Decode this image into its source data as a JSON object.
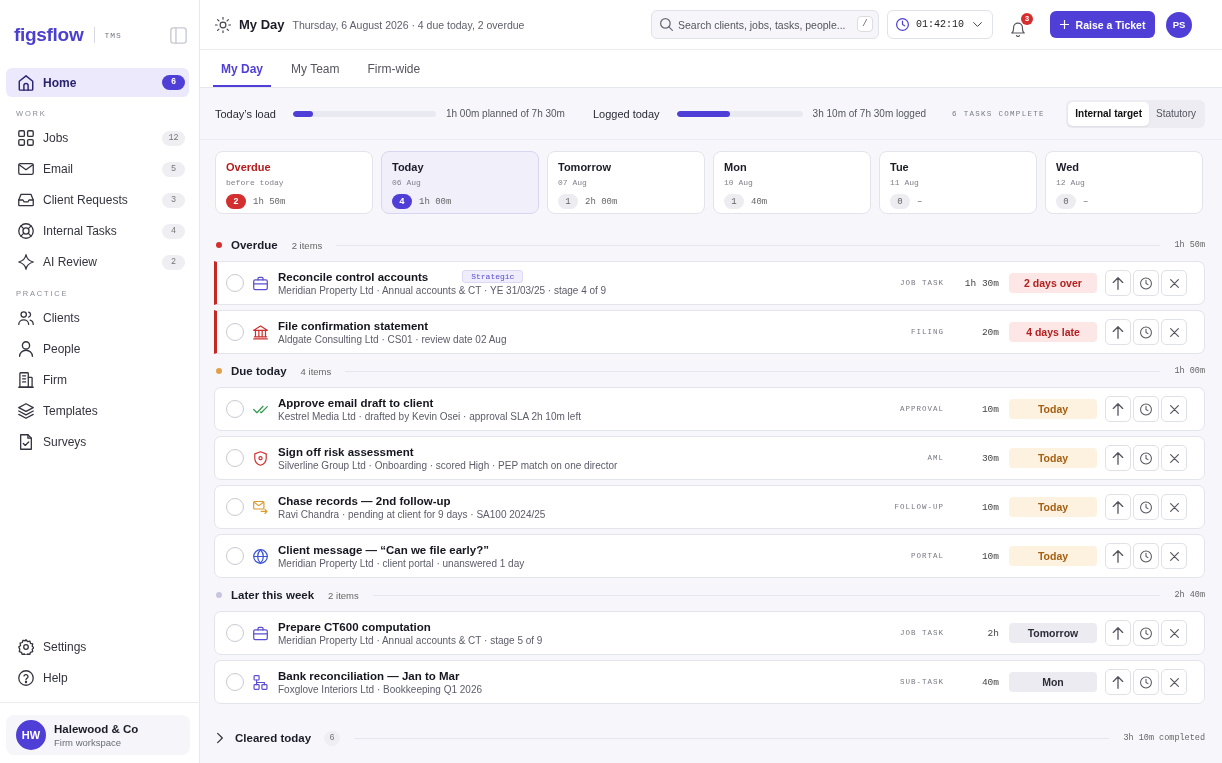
{
  "sidebar": {
    "brand": "figsflow",
    "product": "TMS",
    "sections": [
      {
        "items": [
          {
            "label": "Home",
            "count": "6",
            "selected": true
          }
        ]
      },
      {
        "heading": "WORK",
        "items": [
          {
            "label": "Jobs",
            "count": "12",
            "selected": false
          },
          {
            "label": "Email",
            "count": "5",
            "selected": false
          },
          {
            "label": "Client Requests",
            "count": "3",
            "selected": false
          },
          {
            "label": "Internal Tasks",
            "count": "4",
            "selected": false
          },
          {
            "label": "AI Review",
            "count": "2",
            "selected": false
          }
        ]
      },
      {
        "heading": "PRACTICE",
        "items": [
          {
            "label": "Clients",
            "selected": false
          },
          {
            "label": "People",
            "selected": false
          },
          {
            "label": "Firm",
            "selected": false
          },
          {
            "label": "Templates",
            "selected": false
          },
          {
            "label": "Surveys",
            "selected": false
          }
        ]
      }
    ],
    "footer_items": [
      {
        "label": "Settings",
        "selected": false
      },
      {
        "label": "Help",
        "selected": false
      }
    ],
    "workspace": {
      "initials": "HW",
      "name": "Halewood & Co",
      "subtitle": "Firm workspace"
    }
  },
  "header": {
    "title": "My Day",
    "subtitle": "Thursday, 6 August 2026 · 4 due today, 2 overdue",
    "search": {
      "placeholder": "Search clients, jobs, tasks, people...",
      "shortcut": "/"
    },
    "timer": "01:42:10",
    "notifications": "3",
    "primary_button": "Raise a Ticket",
    "avatar": "PS"
  },
  "tabs": [
    {
      "label": "My Day",
      "selected": true
    },
    {
      "label": "My Team",
      "selected": false
    },
    {
      "label": "Firm-wide",
      "selected": false
    }
  ],
  "load": {
    "meters": [
      {
        "label": "Today’s load",
        "level": 0.14,
        "reading": "1h 00m planned of 7h 30m"
      },
      {
        "label": "Logged today",
        "level": 0.42,
        "reading": "3h 10m of 7h 30m logged"
      }
    ],
    "completed": "6 TASKS COMPLETE",
    "target_options": [
      {
        "label": "Internal target",
        "selected": true
      },
      {
        "label": "Statutory",
        "selected": false
      }
    ]
  },
  "day_cards": [
    {
      "kind": "overdue",
      "title": "Overdue",
      "subtitle": "before today",
      "count": "2",
      "duration": "1h 50m",
      "selected": false
    },
    {
      "kind": "day",
      "title": "Today",
      "subtitle": "06 Aug",
      "count": "4",
      "duration": "1h 00m",
      "selected": true
    },
    {
      "kind": "day",
      "title": "Tomorrow",
      "subtitle": "07 Aug",
      "count": "1",
      "duration": "2h 00m",
      "selected": false
    },
    {
      "kind": "day",
      "title": "Mon",
      "subtitle": "10 Aug",
      "count": "1",
      "duration": "40m",
      "selected": false
    },
    {
      "kind": "day",
      "title": "Tue",
      "subtitle": "11 Aug",
      "count": "0",
      "duration": "–",
      "selected": false
    },
    {
      "kind": "day",
      "title": "Wed",
      "subtitle": "12 Aug",
      "count": "0",
      "duration": "–",
      "selected": false
    }
  ],
  "sections": [
    {
      "title": "Overdue",
      "count": "2 items",
      "total": "1h 50m",
      "color": "#d32f2f",
      "rows": [
        {
          "kind": "job-task",
          "title": "Reconcile control accounts",
          "tag": "Strategic",
          "detail": "Meridian Property Ltd · Annual accounts & CT · YE 31/03/25 · stage 4 of 9",
          "type": "JOB TASK",
          "duration": "1h 30m",
          "status": {
            "kind": "late",
            "text": "2 days over"
          },
          "overdue": true,
          "checked": false
        },
        {
          "kind": "filing",
          "title": "File confirmation statement",
          "detail": "Aldgate Consulting Ltd · CS01 · review date 02 Aug",
          "type": "FILING",
          "duration": "20m",
          "status": {
            "kind": "late",
            "text": "4 days late"
          },
          "overdue": true,
          "checked": false
        }
      ]
    },
    {
      "title": "Due today",
      "count": "4 items",
      "total": "1h 00m",
      "color": "#e3a04a",
      "rows": [
        {
          "kind": "approval",
          "title": "Approve email draft to client",
          "detail": "Kestrel Media Ltd · drafted by Kevin Osei · approval SLA 2h 10m left",
          "type": "APPROVAL",
          "duration": "10m",
          "status": {
            "kind": "today",
            "text": "Today"
          },
          "overdue": false,
          "checked": false
        },
        {
          "kind": "aml",
          "title": "Sign off risk assessment",
          "detail": "Silverline Group Ltd · Onboarding · scored High · PEP match on one director",
          "type": "AML",
          "duration": "30m",
          "status": {
            "kind": "today",
            "text": "Today"
          },
          "overdue": false,
          "checked": false
        },
        {
          "kind": "follow-up",
          "title": "Chase records — 2nd follow-up",
          "detail": "Ravi Chandra · pending at client for 9 days · SA100 2024/25",
          "type": "FOLLOW-UP",
          "duration": "10m",
          "status": {
            "kind": "today",
            "text": "Today"
          },
          "overdue": false,
          "checked": false
        },
        {
          "kind": "portal",
          "title": "Client message — “Can we file early?”",
          "detail": "Meridian Property Ltd · client portal · unanswered 1 day",
          "type": "PORTAL",
          "duration": "10m",
          "status": {
            "kind": "today",
            "text": "Today"
          },
          "overdue": false,
          "checked": false
        }
      ]
    },
    {
      "title": "Later this week",
      "count": "2 items",
      "total": "2h 40m",
      "color": "#c8c5e2",
      "rows": [
        {
          "kind": "job-task",
          "title": "Prepare CT600 computation",
          "detail": "Meridian Property Ltd · Annual accounts & CT · stage 5 of 9",
          "type": "JOB TASK",
          "duration": "2h",
          "status": {
            "kind": "upcoming",
            "text": "Tomorrow"
          },
          "overdue": false,
          "checked": false
        },
        {
          "kind": "sub-task",
          "title": "Bank reconciliation — Jan to Mar",
          "detail": "Foxglove Interiors Ltd · Bookkeeping Q1 2026",
          "type": "SUB-TASK",
          "duration": "40m",
          "status": {
            "kind": "upcoming",
            "text": "Mon"
          },
          "overdue": false,
          "checked": false
        }
      ]
    }
  ],
  "cleared": {
    "title": "Cleared today",
    "count": "6",
    "summary": "3h 10m completed",
    "expanded": false
  }
}
